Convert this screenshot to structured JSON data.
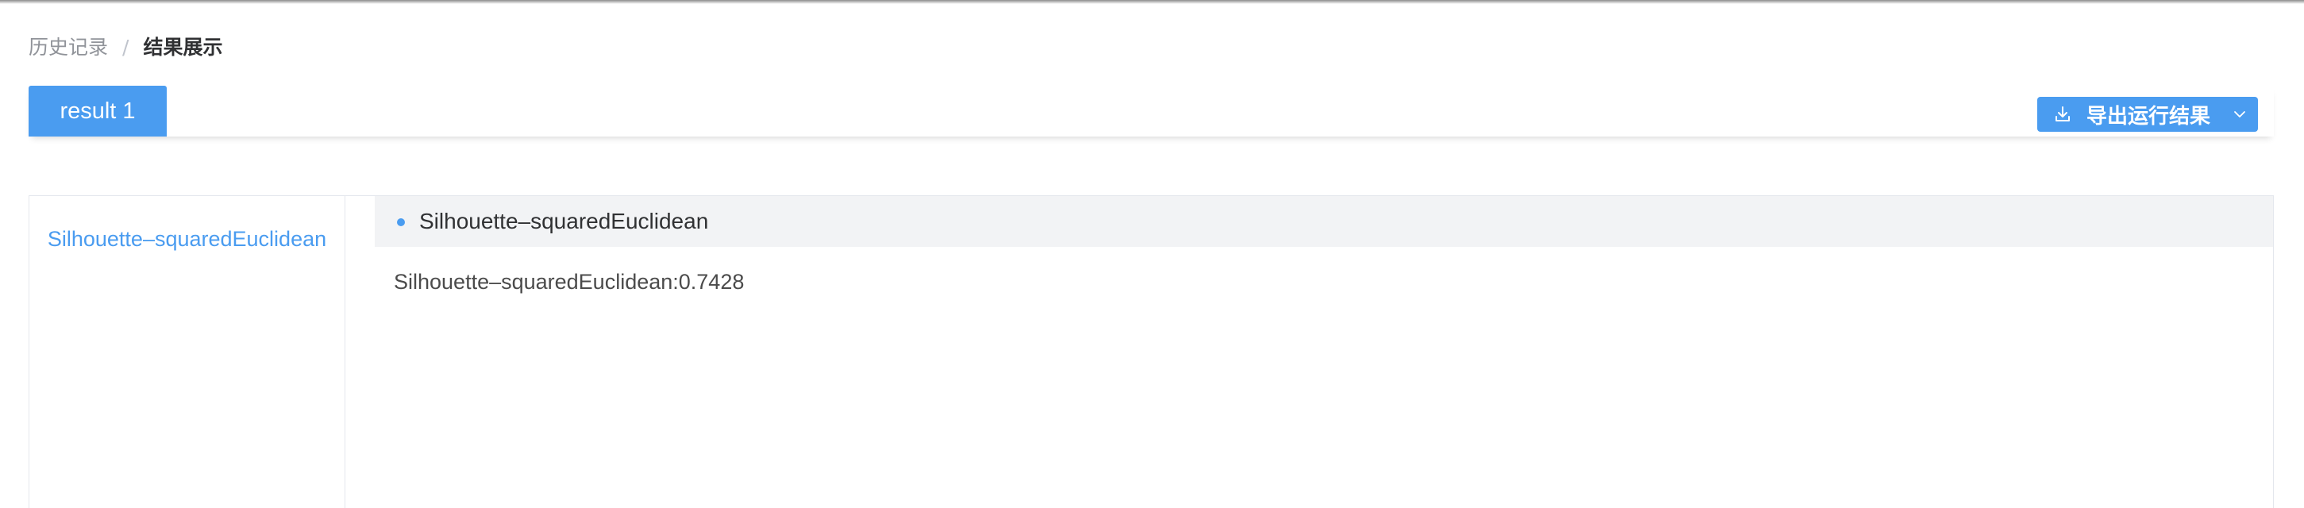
{
  "breadcrumb": {
    "parent": "历史记录",
    "separator": "/",
    "current": "结果展示"
  },
  "tabs": [
    {
      "label": "result 1",
      "active": true
    }
  ],
  "toolbar": {
    "export_label": "导出运行结果",
    "export_icon": "download-icon",
    "dropdown_icon": "chevron-down-icon"
  },
  "sidebar": {
    "items": [
      {
        "label": "Silhouette–squaredEuclidean"
      }
    ]
  },
  "result": {
    "section_title": "Silhouette–squaredEuclidean",
    "metric_line": "Silhouette–squaredEuclidean:0.7428"
  },
  "colors": {
    "accent": "#4a9cf0",
    "header_bg": "#f2f3f5",
    "border": "#e4e7ed"
  }
}
